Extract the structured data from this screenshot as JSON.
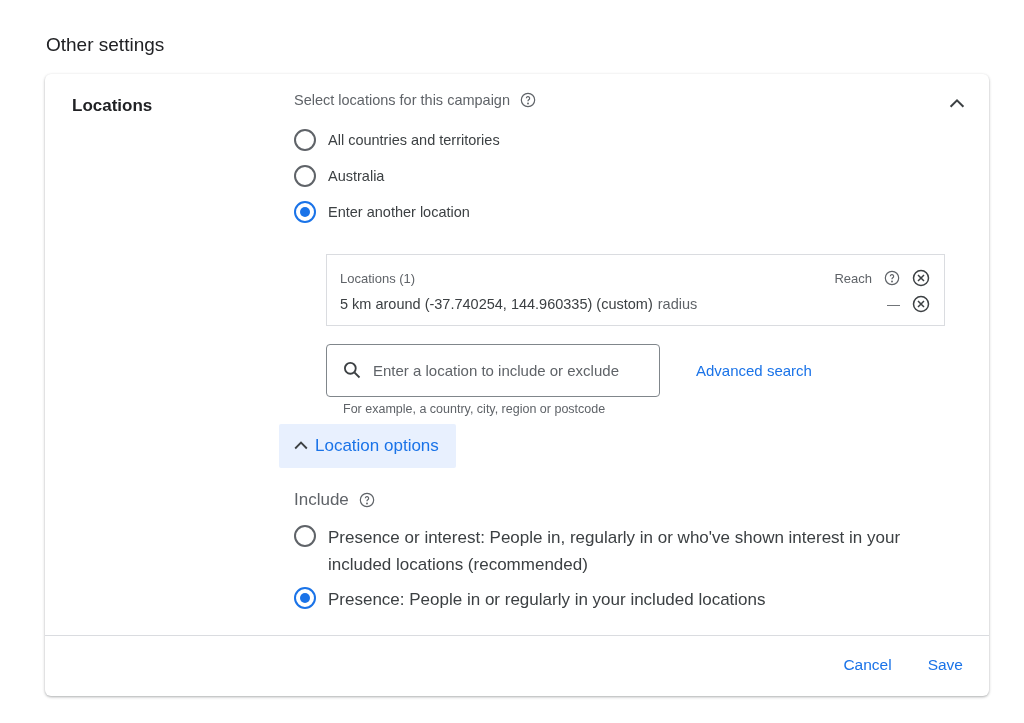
{
  "page_title": "Other settings",
  "section": {
    "title": "Locations",
    "prompt": "Select locations for this campaign",
    "expanded": true,
    "location_choices": [
      {
        "label": "All countries and territories",
        "selected": false
      },
      {
        "label": "Australia",
        "selected": false
      },
      {
        "label": "Enter another location",
        "selected": true
      }
    ],
    "targeted": {
      "heading": "Locations (1)",
      "reach_label": "Reach",
      "items": [
        {
          "text": "5 km around (-37.740254, 144.960335) (custom)",
          "suffix": "radius",
          "reach": "—"
        }
      ]
    },
    "search": {
      "placeholder": "Enter a location to include or exclude",
      "hint": "For example, a country, city, region or postcode"
    },
    "advanced_link": "Advanced search",
    "options_toggle": {
      "label": "Location options",
      "expanded": true
    },
    "include": {
      "label": "Include",
      "choices": [
        {
          "label": "Presence or interest: People in, regularly in or who've shown interest in your included locations (recommended)",
          "selected": false
        },
        {
          "label": "Presence: People in or regularly in your included locations",
          "selected": true
        }
      ]
    }
  },
  "footer": {
    "buttons": [
      "Cancel",
      "Save"
    ]
  }
}
